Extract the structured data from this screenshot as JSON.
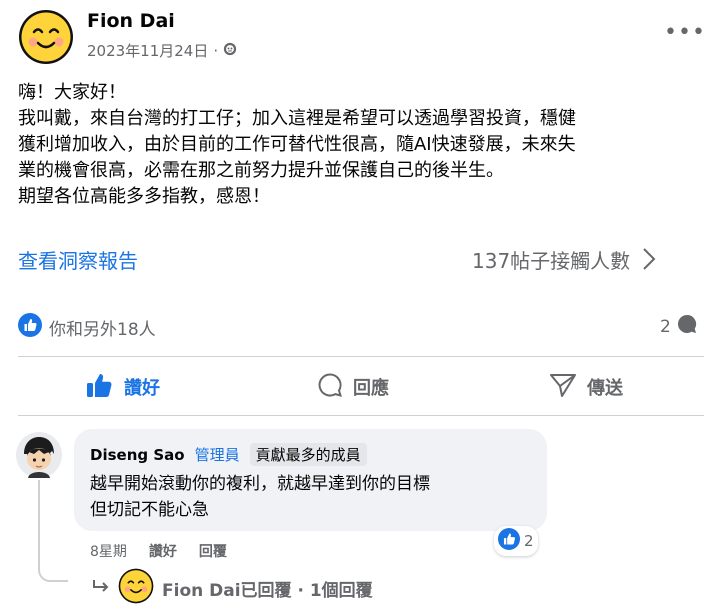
{
  "post": {
    "author": "Fion Dai",
    "date": "2023年11月24日",
    "separator": "·",
    "paragraph": [
      "嗨！大家好！",
      "我叫戴，來自台灣的打工仔；加入這裡是希望可以透過學習投資，穩健",
      "獲利增加收入，由於目前的工作可替代性很高，隨AI快速發展，未來失",
      "業的機會很高，必需在那之前努力提升並保護自己的後半生。",
      "期望各位高能多多指教，感恩！"
    ],
    "insights_label": "查看洞察報告",
    "reach_label": "137帖子接觸人數",
    "reactions_text": "你和另外18人",
    "comment_count": "2"
  },
  "actions": {
    "like": "讚好",
    "comment": "回應",
    "share": "傳送"
  },
  "comment": {
    "author": "Diseng Sao",
    "role": "管理員",
    "badge": "貢獻最多的成員",
    "lines": [
      "越早開始滾動你的複利，就越早達到你的目標",
      "但切記不能心急"
    ],
    "reaction_count": "2",
    "time": "8星期",
    "like_label": "讚好",
    "reply_label": "回覆",
    "reply_summary": "Fion Dai已回覆 · 1個回覆"
  },
  "colors": {
    "accent": "#1b74e4",
    "secondary_text": "#65676b",
    "bubble": "#f0f2f5",
    "smiley": "#ffd43b"
  },
  "icons": [
    "smiley-avatar",
    "globe-icon",
    "more-icon",
    "chevron-right-icon",
    "like-reaction-icon",
    "comment-bubble-icon",
    "thumbs-up-icon",
    "share-icon",
    "reply-arrow-icon"
  ]
}
